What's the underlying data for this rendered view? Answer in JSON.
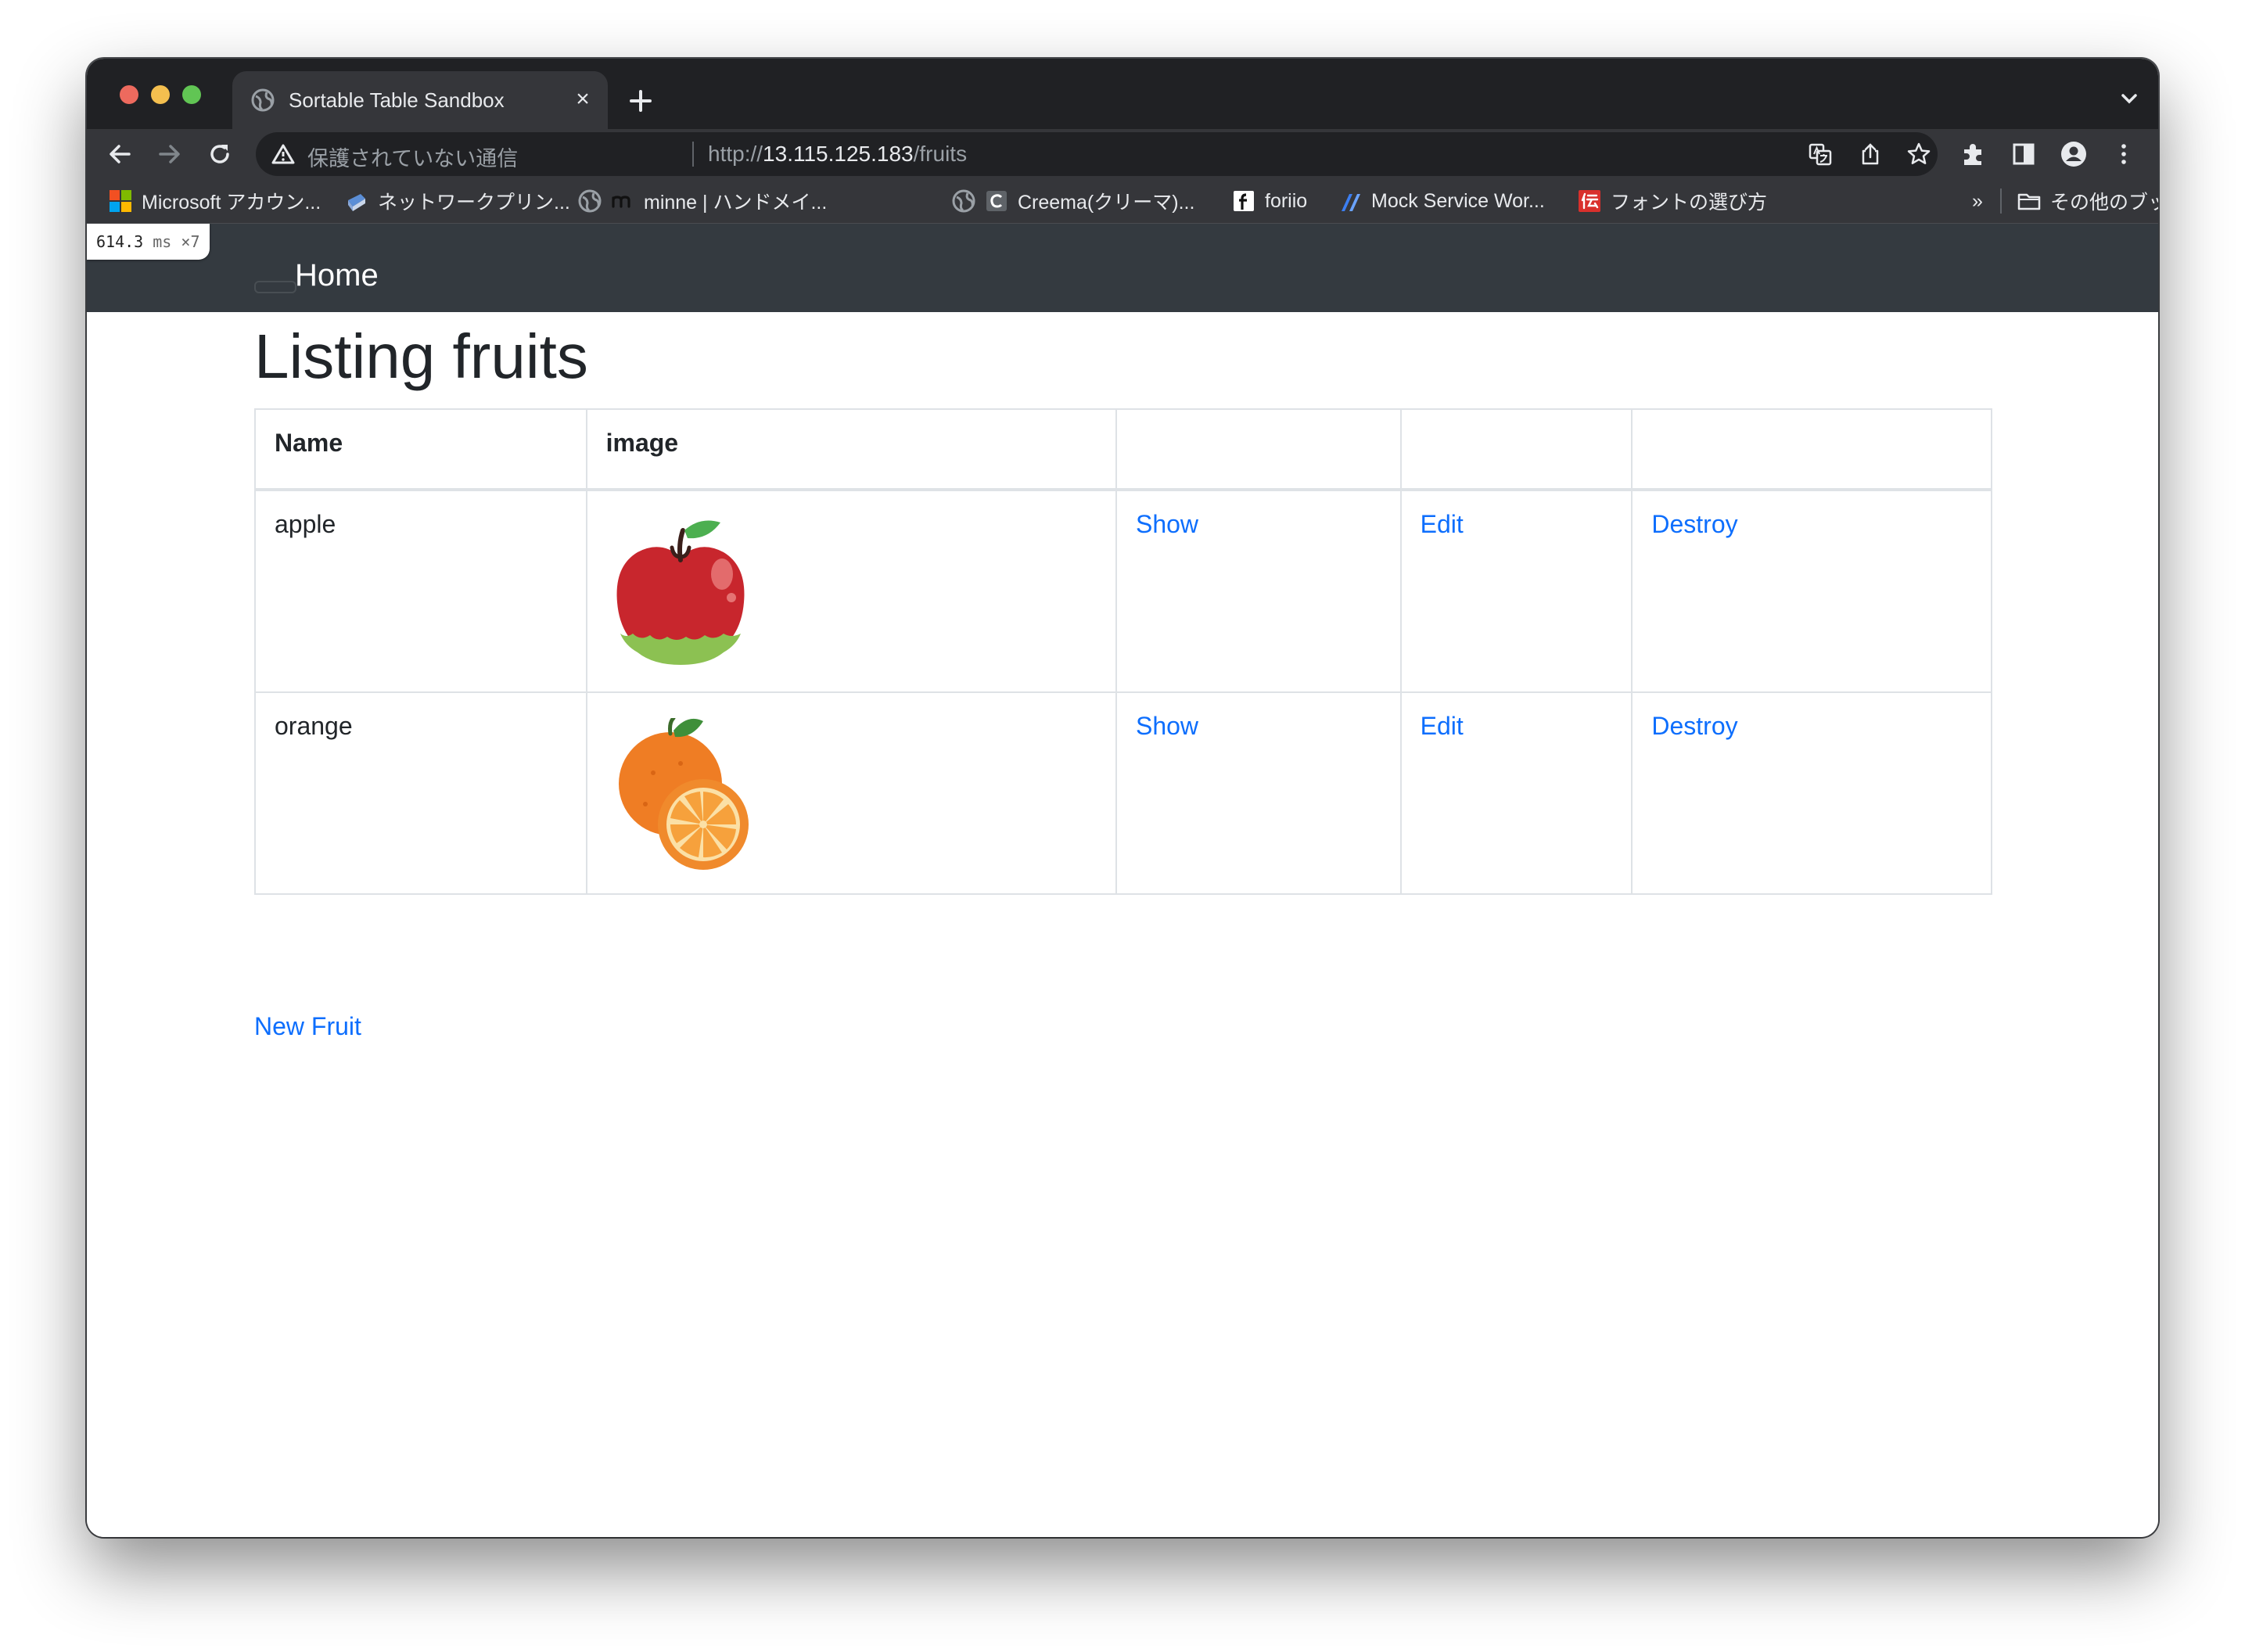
{
  "browser": {
    "tab_title": "Sortable Table Sandbox",
    "tab_close": "×",
    "security_text": "保護されていない通信",
    "url_scheme": "http://",
    "url_host": "13.115.125.183",
    "url_path": "/fruits",
    "bookmarks": [
      "Microsoft アカウン...",
      "ネットワークプリン...",
      "minne | ハンドメイ...",
      "Creema(クリーマ)...",
      "foriio",
      "Mock Service Wor...",
      "フォントの選び方"
    ],
    "bookmarks_overflow": "»",
    "other_bookmarks": "その他のブックマーク",
    "icons": [
      "back-icon",
      "forward-icon",
      "reload-icon",
      "translate-icon",
      "share-icon",
      "star-icon",
      "extensions-icon",
      "side-panel-icon",
      "profile-icon",
      "menu-icon"
    ]
  },
  "perf_badge": {
    "value": "614.3",
    "unit": "ms",
    "multiplier": "×7"
  },
  "navbar": {
    "home_label": "Home"
  },
  "main": {
    "title": "Listing fruits",
    "table": {
      "headers": [
        "Name",
        "image",
        "",
        "",
        ""
      ],
      "rows": [
        {
          "name": "apple",
          "image": "apple-illustration",
          "show": "Show",
          "edit": "Edit",
          "destroy": "Destroy"
        },
        {
          "name": "orange",
          "image": "orange-illustration",
          "show": "Show",
          "edit": "Edit",
          "destroy": "Destroy"
        }
      ]
    },
    "new_link": "New Fruit"
  },
  "colors": {
    "link": "#0d6efd",
    "navbar": "#343a40",
    "browser_chrome": "#35363a"
  }
}
